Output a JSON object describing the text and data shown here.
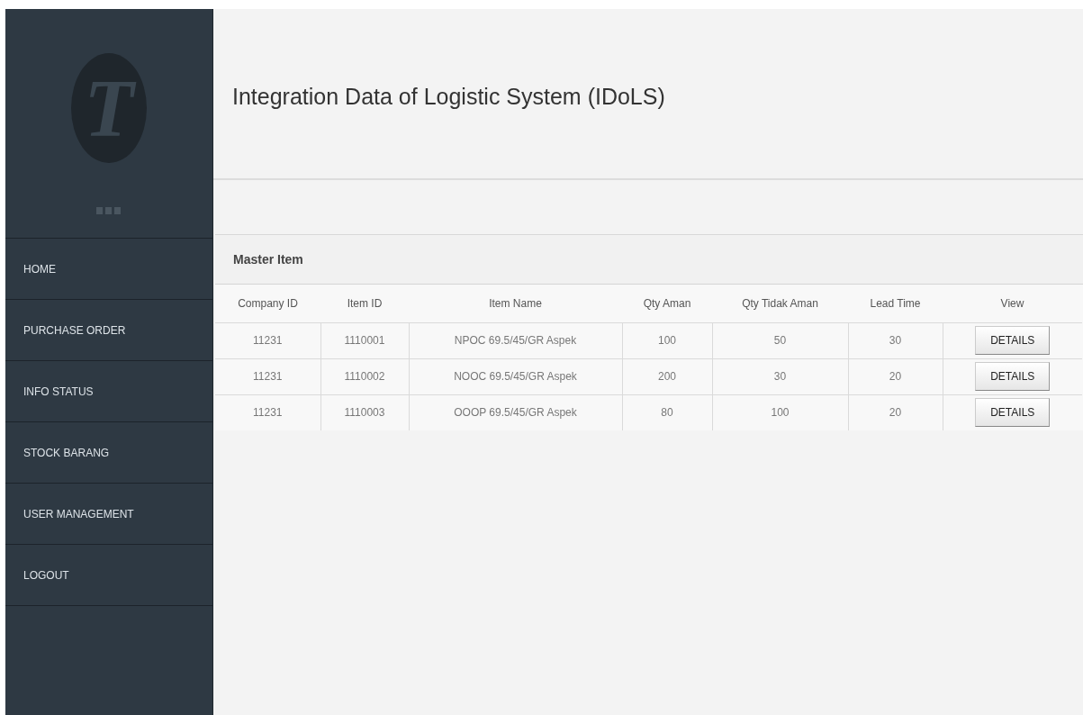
{
  "sidebar": {
    "logo_letter": "T",
    "items": [
      {
        "label": "HOME",
        "selected": false
      },
      {
        "label": "PURCHASE ORDER",
        "selected": false
      },
      {
        "label": "INFO STATUS",
        "selected": false
      },
      {
        "label": "STOCK BARANG",
        "selected": false
      },
      {
        "label": "USER MANAGEMENT",
        "selected": false
      },
      {
        "label": "LOGOUT",
        "selected": false
      }
    ]
  },
  "header": {
    "title": "Integration Data of Logistic System (IDoLS)"
  },
  "panel": {
    "title": "Master Item",
    "table": {
      "columns": [
        "Company ID",
        "Item ID",
        "Item Name",
        "Qty Aman",
        "Qty Tidak Aman",
        "Lead Time",
        "View"
      ],
      "rows": [
        {
          "cells": [
            "11231",
            "1110001",
            "NPOC 69.5/45/GR Aspek",
            "100",
            "50",
            "30"
          ],
          "button": "DETAILS"
        },
        {
          "cells": [
            "11231",
            "1110002",
            "NOOC 69.5/45/GR Aspek",
            "200",
            "30",
            "20"
          ],
          "button": "DETAILS"
        },
        {
          "cells": [
            "11231",
            "1110003",
            "OOOP 69.5/45/GR Aspek",
            "80",
            "100",
            "20"
          ],
          "button": "DETAILS"
        }
      ]
    }
  }
}
